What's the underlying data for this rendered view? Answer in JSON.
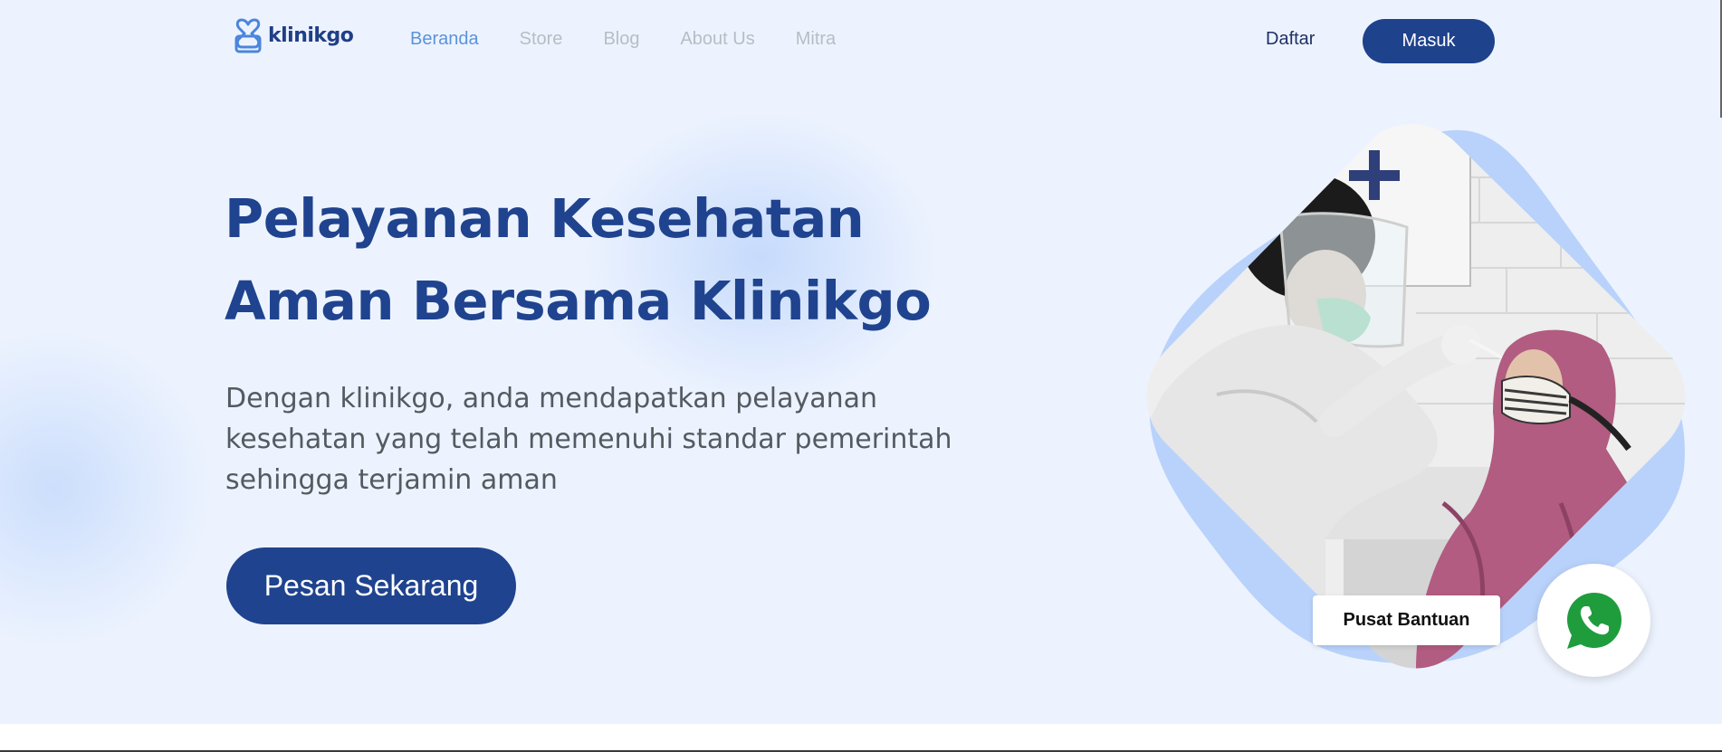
{
  "brand": {
    "name": "klinikgo"
  },
  "nav": {
    "items": [
      {
        "label": "Beranda",
        "active": true
      },
      {
        "label": "Store",
        "active": false
      },
      {
        "label": "Blog",
        "active": false
      },
      {
        "label": "About Us",
        "active": false
      },
      {
        "label": "Mitra",
        "active": false
      }
    ],
    "register_label": "Daftar",
    "login_label": "Masuk"
  },
  "hero": {
    "headline_line1": "Pelayanan Kesehatan",
    "headline_line2": "Aman Bersama Klinikgo",
    "subtitle_line1": "Dengan klinikgo, anda mendapatkan pelayanan",
    "subtitle_line2": "kesehatan yang telah memenuhi standar pemerintah",
    "subtitle_line3": "sehingga terjamin aman",
    "cta_label": "Pesan Sekarang"
  },
  "help": {
    "label": "Pusat Bantuan",
    "icon": "whatsapp-icon"
  },
  "colors": {
    "primary": "#1f438e",
    "nav_active": "#5b93dc",
    "nav_inactive": "#b8bcc4",
    "hero_bg": "#edf3fe",
    "blob": "#b9d2fb",
    "whatsapp": "#1f9d3d"
  }
}
